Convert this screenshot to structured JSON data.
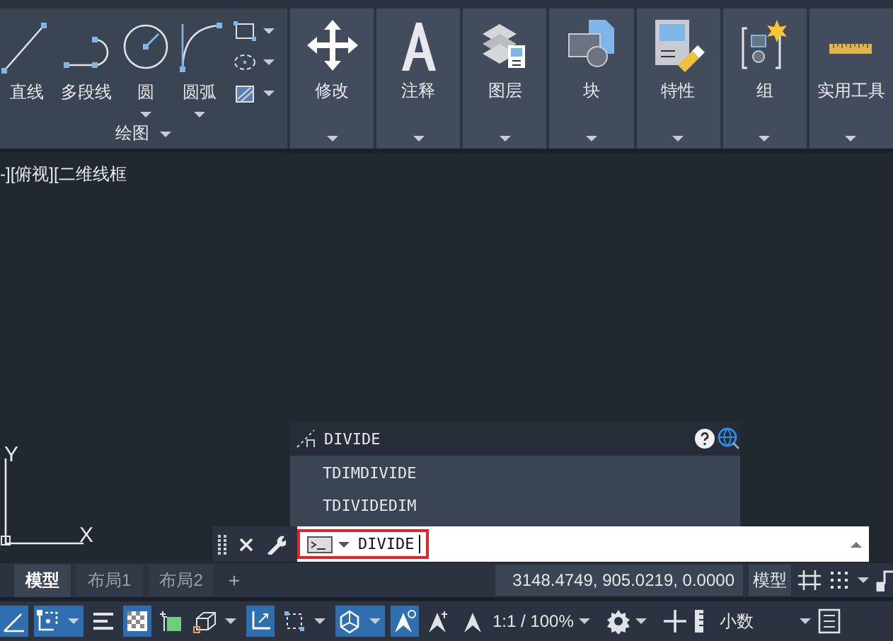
{
  "ribbon": {
    "draw_panel": {
      "title": "绘图",
      "tools": [
        {
          "kind": "line",
          "label": "直线",
          "menu": false
        },
        {
          "kind": "polyline",
          "label": "多段线",
          "menu": false
        },
        {
          "kind": "circle",
          "label": "圆",
          "menu": true
        },
        {
          "kind": "arc",
          "label": "圆弧",
          "menu": true
        }
      ],
      "small_tools": [
        {
          "kind": "rectangle"
        },
        {
          "kind": "ellipse"
        },
        {
          "kind": "hatch"
        }
      ]
    },
    "panels": [
      {
        "kind": "move",
        "label": "修改"
      },
      {
        "kind": "text",
        "label": "注释"
      },
      {
        "kind": "layers",
        "label": "图层"
      },
      {
        "kind": "block",
        "label": "块"
      },
      {
        "kind": "properties",
        "label": "特性"
      },
      {
        "kind": "group",
        "label": "组"
      },
      {
        "kind": "ruler",
        "label": "实用工具"
      }
    ]
  },
  "viewport": {
    "label": "-][俯视][二维线框"
  },
  "ucs": {
    "y_label": "Y",
    "x_label": "X"
  },
  "autocomplete": {
    "current": "DIVIDE",
    "suggestions": [
      "TDIMDIVIDE",
      "TDIVIDEDIM"
    ]
  },
  "command_line": {
    "value": "DIVIDE"
  },
  "layout_tabs": [
    {
      "label": "模型",
      "selected": true
    },
    {
      "label": "布局1",
      "selected": false
    },
    {
      "label": "布局2",
      "selected": false
    }
  ],
  "add_tab": "+",
  "status": {
    "coordinates": "3148.4749, 905.0219, 0.0000",
    "space": "模型",
    "scale": "1:1 / 100%",
    "units": "小数",
    "toggles": [
      {
        "kind": "angle",
        "on": true,
        "menu": false
      },
      {
        "kind": "snap",
        "on": true,
        "menu": true
      },
      {
        "kind": "lineweight",
        "on": false,
        "menu": false
      },
      {
        "kind": "transparency",
        "on": true,
        "menu": false
      },
      {
        "kind": "cycle",
        "on": false,
        "menu": false
      },
      {
        "kind": "box",
        "on": false,
        "menu": true
      },
      {
        "kind": "ucs",
        "on": true,
        "menu": false
      },
      {
        "kind": "select",
        "on": false,
        "menu": true
      },
      {
        "kind": "gizmo",
        "on": true,
        "menu": true
      },
      {
        "kind": "annotation",
        "on": true,
        "menu": false
      },
      {
        "kind": "autoscale",
        "on": false,
        "menu": false
      },
      {
        "kind": "scale",
        "on": false,
        "menu": false
      }
    ]
  }
}
